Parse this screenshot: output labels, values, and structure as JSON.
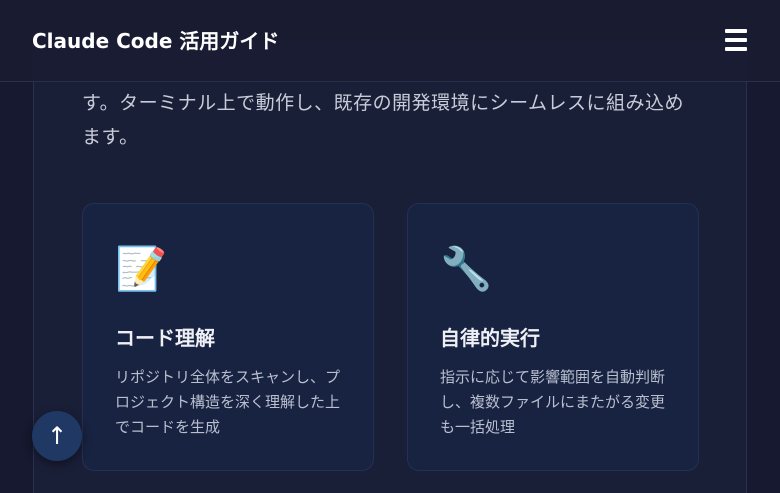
{
  "header": {
    "title": "Claude Code 活用ガイド",
    "menu_icon": "hamburger-menu-icon"
  },
  "intro": {
    "text": "す。ターミナル上で動作し、既存の開発環境にシームレスに組み込めます。"
  },
  "cards": [
    {
      "icon": "📝",
      "icon_name": "memo-icon",
      "title": "コード理解",
      "description": "リポジトリ全体をスキャンし、プロジェクト構造を深く理解した上でコードを生成"
    },
    {
      "icon": "🔧",
      "icon_name": "wrench-icon",
      "title": "自律的実行",
      "description": "指示に応じて影響範囲を自動判断し、複数ファイルにまたがる変更も一括処理"
    }
  ],
  "scroll_top": {
    "label": "↑",
    "icon_name": "arrow-up-icon"
  }
}
